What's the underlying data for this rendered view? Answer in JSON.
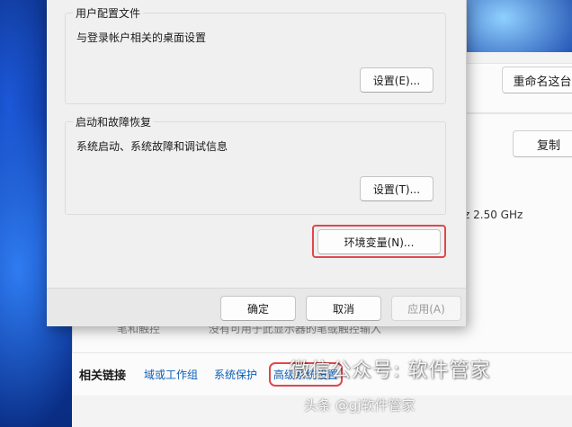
{
  "dialog": {
    "user_profiles": {
      "group_label": "用户配置文件",
      "description": "与登录帐户相关的桌面设置",
      "settings_button": "设置(E)..."
    },
    "startup_recovery": {
      "group_label": "启动和故障恢复",
      "description": "系统启动、系统故障和调试信息",
      "settings_button": "设置(T)..."
    },
    "env_vars_button": "环境变量(N)...",
    "footer": {
      "ok": "确定",
      "cancel": "取消",
      "apply": "应用(A)"
    }
  },
  "settings": {
    "rename_button": "重命名这台",
    "copy_button": "复制",
    "processor_fragment": "z   2.50 GHz",
    "pen_touch_label": "笔和触控",
    "pen_touch_value": "没有可用于此显示器的笔或触控输入",
    "related_links": {
      "title": "相关链接",
      "domain_workgroup": "域或工作组",
      "system_protection": "系统保护",
      "advanced_settings": "高级系统设置"
    }
  },
  "watermark": {
    "line1": "微信公众号: 软件管家",
    "line2": "头条 @gj软件管家"
  },
  "colors": {
    "highlight": "#e0474c",
    "link": "#0a5fb8"
  }
}
